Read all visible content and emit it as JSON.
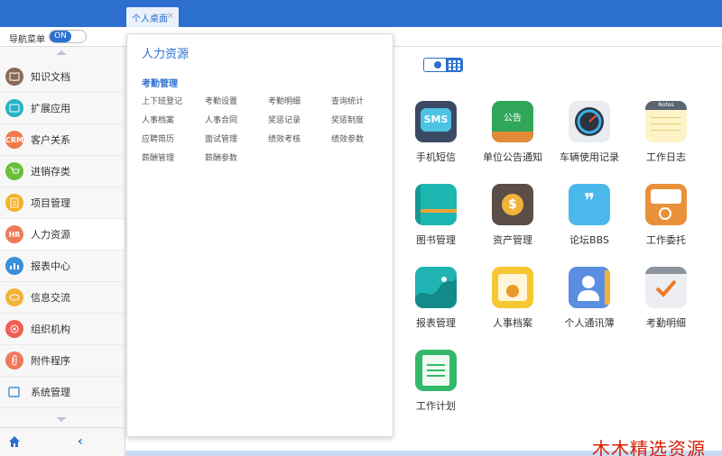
{
  "tabs": [
    {
      "label": "个人桌面",
      "close": "×"
    }
  ],
  "nav_toggle": {
    "label": "导航菜单",
    "state": "ON"
  },
  "sidebar": {
    "items": [
      {
        "label": "知识文档",
        "icon": "book-icon",
        "color": "#8b6a55",
        "active": false
      },
      {
        "label": "扩展应用",
        "icon": "extension-icon",
        "color": "#27b2c6",
        "active": false
      },
      {
        "label": "客户关系",
        "icon": "crm-icon",
        "glyph": "CRM",
        "color": "#f07a4a",
        "active": false
      },
      {
        "label": "进销存类",
        "icon": "cart-icon",
        "color": "#6bbf3a",
        "active": false
      },
      {
        "label": "项目管理",
        "icon": "clipboard-icon",
        "color": "#f3b22a",
        "active": false
      },
      {
        "label": "人力资源",
        "icon": "hr-icon",
        "glyph": "HR",
        "color": "#f0795a",
        "active": true
      },
      {
        "label": "报表中心",
        "icon": "chart-icon",
        "color": "#3b8fd9",
        "active": false
      },
      {
        "label": "信息交流",
        "icon": "chat-icon",
        "color": "#f2b23a",
        "active": false
      },
      {
        "label": "组织机构",
        "icon": "org-icon",
        "color": "#ef5f55",
        "active": false
      },
      {
        "label": "附件程序",
        "icon": "paperclip-icon",
        "color": "#f0795a",
        "active": false
      },
      {
        "label": "系统管理",
        "icon": "window-icon",
        "color": "#3b8fd9",
        "active": false
      }
    ]
  },
  "flyout": {
    "title": "人力资源",
    "section": "考勤管理",
    "links": [
      "上下班登记",
      "考勤设置",
      "考勤明细",
      "查询统计",
      "人事档案",
      "人事合同",
      "奖惩记录",
      "奖惩制度",
      "应聘简历",
      "面试管理",
      "绩效考核",
      "绩效参数",
      "薪酬管理",
      "薪酬参数"
    ]
  },
  "apps": [
    {
      "label": "手机短信",
      "icon": "sms-icon",
      "glyph": "SMS"
    },
    {
      "label": "单位公告通知",
      "icon": "notice-board-icon",
      "glyph": "公告"
    },
    {
      "label": "车辆使用记录",
      "icon": "speedometer-icon"
    },
    {
      "label": "工作日志",
      "icon": "notes-icon",
      "glyph": "Notes"
    },
    {
      "label": "图书管理",
      "icon": "library-book-icon"
    },
    {
      "label": "资产管理",
      "icon": "wallet-icon",
      "glyph": "$"
    },
    {
      "label": "论坛BBS",
      "icon": "quote-bubble-icon",
      "glyph": "❞"
    },
    {
      "label": "工作委托",
      "icon": "delegate-card-icon"
    },
    {
      "label": "报表管理",
      "icon": "report-chart-icon"
    },
    {
      "label": "人事档案",
      "icon": "personnel-file-icon"
    },
    {
      "label": "个人通讯薄",
      "icon": "contacts-icon"
    },
    {
      "label": "考勤明细",
      "icon": "calendar-check-icon"
    },
    {
      "label": "工作计划",
      "icon": "plan-list-icon"
    }
  ],
  "watermark": "木木精选资源"
}
